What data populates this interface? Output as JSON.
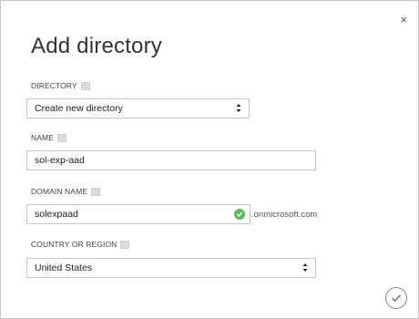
{
  "dialog": {
    "title": "Add directory",
    "close_glyph": "×"
  },
  "fields": {
    "directory": {
      "label": "DIRECTORY",
      "value": "Create new directory"
    },
    "name": {
      "label": "NAME",
      "value": "sol-exp-aad"
    },
    "domain_name": {
      "label": "DOMAIN NAME",
      "value": "solexpaad",
      "suffix": ".onmicrosoft.com",
      "status": "valid",
      "status_color": "#5cb85c"
    },
    "country": {
      "label": "COUNTRY OR REGION",
      "value": "United States"
    }
  },
  "icons": {
    "help": "help-icon",
    "valid": "check-circle-icon",
    "confirm": "checkmark-circle-icon"
  }
}
